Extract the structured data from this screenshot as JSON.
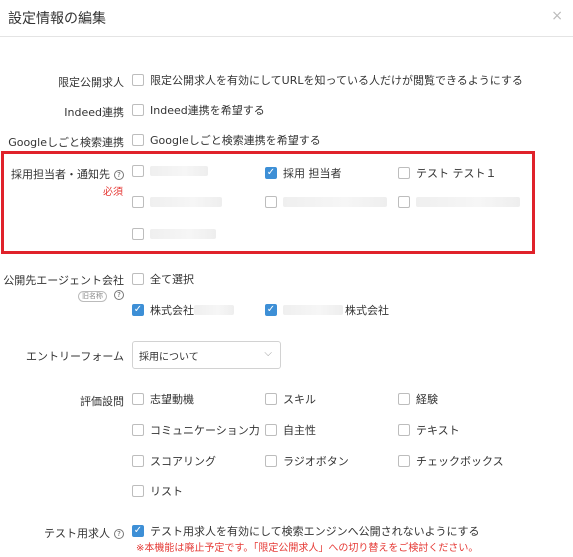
{
  "modal": {
    "title": "設定情報の編集",
    "close_glyph": "×"
  },
  "limited_public": {
    "label": "限定公開求人",
    "option": "限定公開求人を有効にしてURLを知っている人だけが閲覧できるようにする",
    "checked": false
  },
  "indeed": {
    "label": "Indeed連携",
    "option": "Indeed連携を希望する",
    "checked": false
  },
  "google": {
    "label": "Googleしごと検索連携",
    "option": "Googleしごと検索連携を希望する",
    "checked": false
  },
  "recruiter": {
    "label": "採用担当者・通知先",
    "help_glyph": "?",
    "required": "必須",
    "options": [
      {
        "label": "",
        "checked": false
      },
      {
        "label": "採用 担当者",
        "checked": true
      },
      {
        "label": "テスト テスト１",
        "checked": false
      },
      {
        "label": "",
        "checked": false
      },
      {
        "label": "",
        "checked": false
      },
      {
        "label": "",
        "checked": false
      },
      {
        "label": "",
        "checked": false
      }
    ]
  },
  "agent": {
    "label": "公開先エージェント会社",
    "badge": "旧名称",
    "help_glyph": "?",
    "select_all": "全て選択",
    "companies": [
      {
        "prefix": "株式会社",
        "suffix": "",
        "checked": true
      },
      {
        "prefix": "",
        "suffix": "株式会社",
        "checked": true
      }
    ]
  },
  "entry_form": {
    "label": "エントリーフォーム",
    "value": "採用について",
    "chevron_glyph": "⌵"
  },
  "evaluation": {
    "label": "評価設問",
    "options": [
      {
        "label": "志望動機",
        "checked": false
      },
      {
        "label": "スキル",
        "checked": false
      },
      {
        "label": "経験",
        "checked": false
      },
      {
        "label": "コミュニケーション力",
        "checked": false
      },
      {
        "label": "自主性",
        "checked": false
      },
      {
        "label": "テキスト",
        "checked": false
      },
      {
        "label": "スコアリング",
        "checked": false
      },
      {
        "label": "ラジオボタン",
        "checked": false
      },
      {
        "label": "チェックボックス",
        "checked": false
      },
      {
        "label": "リスト",
        "checked": false
      }
    ]
  },
  "test_job": {
    "label": "テスト用求人",
    "help_glyph": "?",
    "option": "テスト用求人を有効にして検索エンジンへ公開されないようにする",
    "checked": true,
    "note": "※本機能は廃止予定です。「限定公開求人」への切り替えをご検討ください。"
  },
  "check_glyph": "✓",
  "colors": {
    "accent": "#3d8fd6",
    "warning": "#e53935",
    "highlight_box": "#e0222a"
  }
}
